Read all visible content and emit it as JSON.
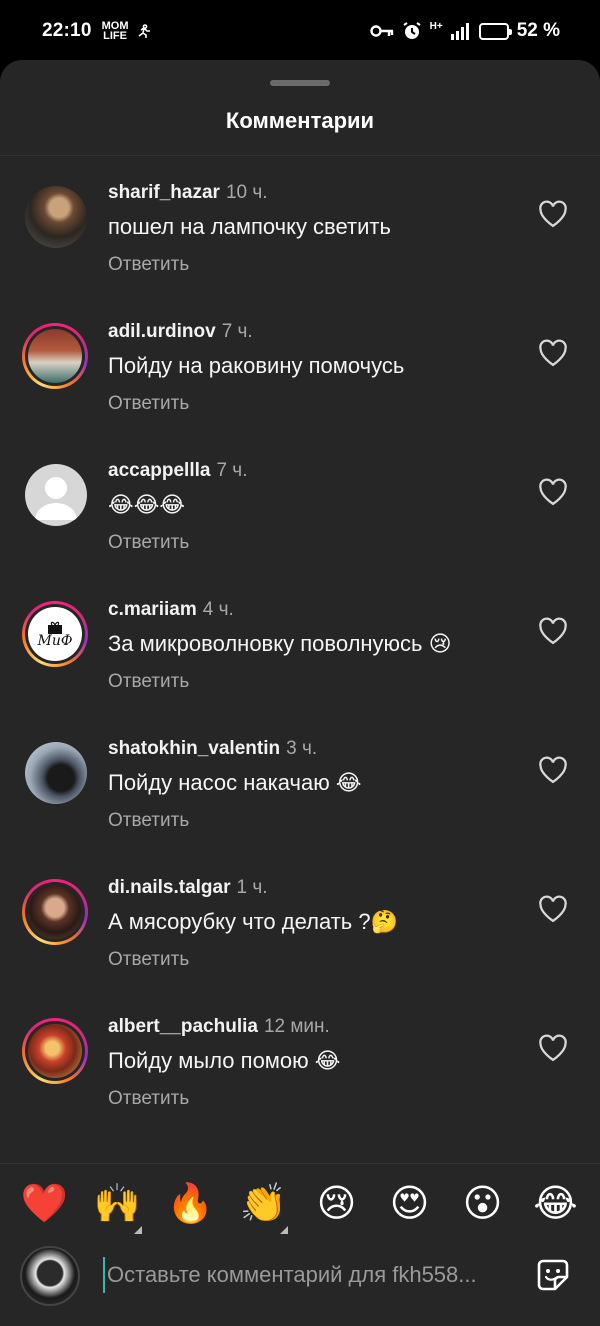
{
  "status_bar": {
    "time": "22:10",
    "app_badge_top": "MOM",
    "app_badge_bottom": "LIFE",
    "network": "H+",
    "battery_percent": 52,
    "battery_text": "52 %"
  },
  "sheet": {
    "title": "Комментарии"
  },
  "comments": [
    {
      "username": "sharif_hazar",
      "ago": "10 ч.",
      "text": "пошел на лампочку светить",
      "reply": "Ответить",
      "avatar_ring": false
    },
    {
      "username": "adil.urdinov",
      "ago": "7 ч.",
      "text": "Пойду на раковину помочусь",
      "reply": "Ответить",
      "avatar_ring": true
    },
    {
      "username": "accappellla",
      "ago": "7 ч.",
      "text": "😂😂😂",
      "reply": "Ответить",
      "avatar_ring": false
    },
    {
      "username": "c.mariiam",
      "ago": "4 ч.",
      "text": "За микроволновку поволнуюсь 😢",
      "reply": "Ответить",
      "avatar_ring": true,
      "avatar_logo_text": "МиФ"
    },
    {
      "username": "shatokhin_valentin",
      "ago": "3 ч.",
      "text": "Пойду насос накачаю 😂",
      "reply": "Ответить",
      "avatar_ring": false
    },
    {
      "username": "di.nails.talgar",
      "ago": "1 ч.",
      "text": "А мясорубку что делать ?🤔",
      "reply": "Ответить",
      "avatar_ring": true
    },
    {
      "username": "albert__pachulia",
      "ago": "12 мин.",
      "text": "Пойду мыло помою 😂",
      "reply": "Ответить",
      "avatar_ring": true
    }
  ],
  "quick_emojis": [
    "❤️",
    "🙌",
    "🔥",
    "👏",
    "😢",
    "😍",
    "😮",
    "😂"
  ],
  "composer": {
    "placeholder": "Оставьте комментарий для fkh558..."
  },
  "colors": {
    "sheet_bg": "#262626",
    "muted_text": "#a8a8a8",
    "story_ring": "#d62976",
    "cursor": "#3ab5b0"
  },
  "icons": {
    "like": "heart-outline-icon",
    "sticker": "sticker-icon",
    "key": "key-icon",
    "alarm": "alarm-icon"
  }
}
